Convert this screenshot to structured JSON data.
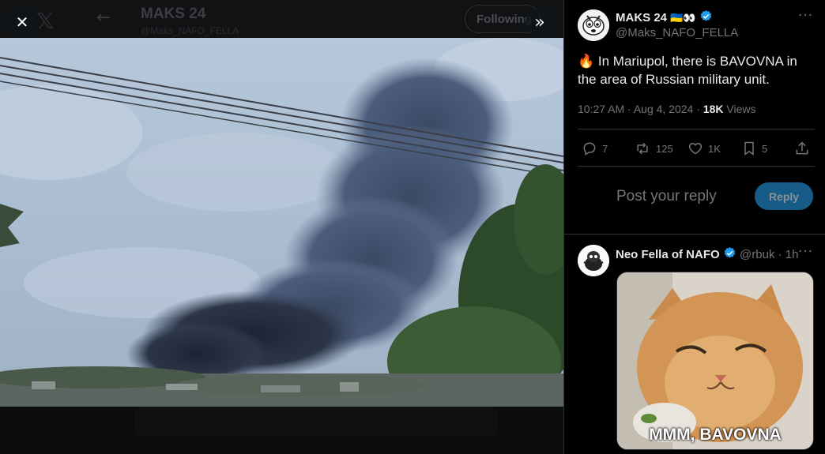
{
  "viewer": {
    "background_header": {
      "name": "MAKS 24",
      "sub": "@Maks_NAFO_FELLA",
      "follow_label": "Following"
    },
    "close_icon": "close-icon",
    "expand_icon": "double-chevron-right-icon"
  },
  "post": {
    "author": {
      "name": "MAKS 24",
      "emoji": "🇺🇦👀",
      "handle": "@Maks_NAFO_FELLA",
      "verified": true
    },
    "text": "🔥 In Mariupol, there is BAVOVNA in the area of Russian military unit.",
    "time": "10:27 AM",
    "date": "Aug 4, 2024",
    "views_count": "18K",
    "views_label": "Views",
    "actions": {
      "replies": "7",
      "reposts": "125",
      "likes": "1K",
      "bookmarks": "5"
    }
  },
  "reply_box": {
    "placeholder": "Post your reply",
    "button_label": "Reply"
  },
  "reply": {
    "author": {
      "name": "Neo Fella of NAFO",
      "handle": "@rbuk",
      "time": "1h",
      "verified": true
    },
    "image_caption": "MMM, BAVOVNA"
  },
  "colors": {
    "accent": "#1d9bf0",
    "reply_button": "#175b89",
    "muted_text": "#71767b",
    "border": "#2f3336"
  }
}
